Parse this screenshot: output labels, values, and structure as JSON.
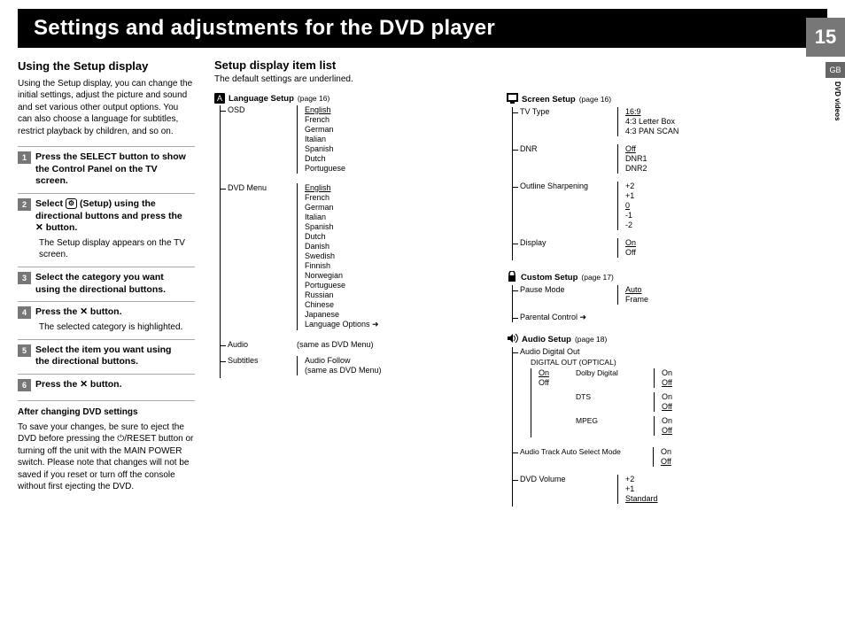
{
  "header": {
    "title": "Settings and adjustments for the DVD player",
    "page_number": "15",
    "locale_tab": "GB",
    "side_label": "DVD videos"
  },
  "left": {
    "h_using": "Using the Setup display",
    "intro": "Using the Setup display, you can change the initial settings, adjust the picture and sound and set various other output options. You can also choose a language for subtitles, restrict playback by children, and so on.",
    "steps": [
      {
        "n": "1",
        "title": "Press the SELECT button to show the Control Panel on the TV screen.",
        "note": ""
      },
      {
        "n": "2",
        "title": "Select  (Setup) using the directional buttons and press the ✕ button.",
        "note": "The Setup display appears on the TV screen.",
        "icon_before": "setup"
      },
      {
        "n": "3",
        "title": "Select the category you want using the directional buttons.",
        "note": ""
      },
      {
        "n": "4",
        "title": "Press the ✕ button.",
        "note": "The selected category is highlighted."
      },
      {
        "n": "5",
        "title": "Select the item you want using the directional buttons.",
        "note": ""
      },
      {
        "n": "6",
        "title": "Press the ✕ button.",
        "note": ""
      }
    ],
    "after_h": "After changing DVD settings",
    "after_p": "To save your changes, be sure to eject the DVD before pressing the ⏻/RESET button or turning off the unit with the MAIN POWER switch.  Please note that changes will not be saved if you reset or turn off the console without first ejecting the DVD."
  },
  "mid": {
    "h_list": "Setup display item list",
    "note": "The default settings are underlined.",
    "language_setup": {
      "icon": "A",
      "title": "Language Setup",
      "page": "(page 16)",
      "osd_label": "OSD",
      "osd": [
        "English",
        "French",
        "German",
        "Italian",
        "Spanish",
        "Dutch",
        "Portuguese"
      ],
      "osd_default": 0,
      "dvd_menu_label": "DVD Menu",
      "dvd_menu": [
        "English",
        "French",
        "German",
        "Italian",
        "Spanish",
        "Dutch",
        "Danish",
        "Swedish",
        "Finnish",
        "Norwegian",
        "Portuguese",
        "Russian",
        "Chinese",
        "Japanese",
        "Language Options ➜"
      ],
      "dvd_menu_default": 0,
      "audio_label": "Audio",
      "audio_val": "(same as DVD Menu)",
      "subtitles_label": "Subtitles",
      "subtitles_vals": [
        "Audio Follow",
        "(same as DVD Menu)"
      ]
    }
  },
  "rightcol": {
    "screen_setup": {
      "icon": "screen",
      "title": "Screen Setup",
      "page": "(page 16)",
      "tv_type_label": "TV Type",
      "tv_type": [
        "16:9",
        "4:3 Letter Box",
        "4:3 PAN SCAN"
      ],
      "tv_type_default": 0,
      "dnr_label": "DNR",
      "dnr": [
        "Off",
        "DNR1",
        "DNR2"
      ],
      "dnr_default": 0,
      "sharp_label": "Outline Sharpening",
      "sharp": [
        "+2",
        "+1",
        "0",
        "-1",
        "-2"
      ],
      "sharp_default": 2,
      "display_label": "Display",
      "display": [
        "On",
        "Off"
      ],
      "display_default": 0
    },
    "custom_setup": {
      "icon": "lock",
      "title": "Custom Setup",
      "page": "(page 17)",
      "pause_label": "Pause Mode",
      "pause": [
        "Auto",
        "Frame"
      ],
      "pause_default": 0,
      "parental_label": "Parental Control ➜"
    },
    "audio_setup": {
      "icon": "audio",
      "title": "Audio Setup",
      "page": "(page 18)",
      "ado_label": "Audio Digital Out",
      "do_label": "DIGITAL OUT (OPTICAL)",
      "do_vals": [
        "On",
        "Off"
      ],
      "do_default": 0,
      "dolby_label": "Dolby Digital",
      "dolby": [
        "On",
        "Off"
      ],
      "dolby_default": 1,
      "dts_label": "DTS",
      "dts": [
        "On",
        "Off"
      ],
      "dts_default": 1,
      "mpeg_label": "MPEG",
      "mpeg": [
        "On",
        "Off"
      ],
      "mpeg_default": 1,
      "track_label": "Audio Track Auto Select Mode",
      "track": [
        "On",
        "Off"
      ],
      "track_default": 1,
      "vol_label": "DVD Volume",
      "vol": [
        "+2",
        "+1",
        "Standard"
      ],
      "vol_default": 2
    }
  }
}
